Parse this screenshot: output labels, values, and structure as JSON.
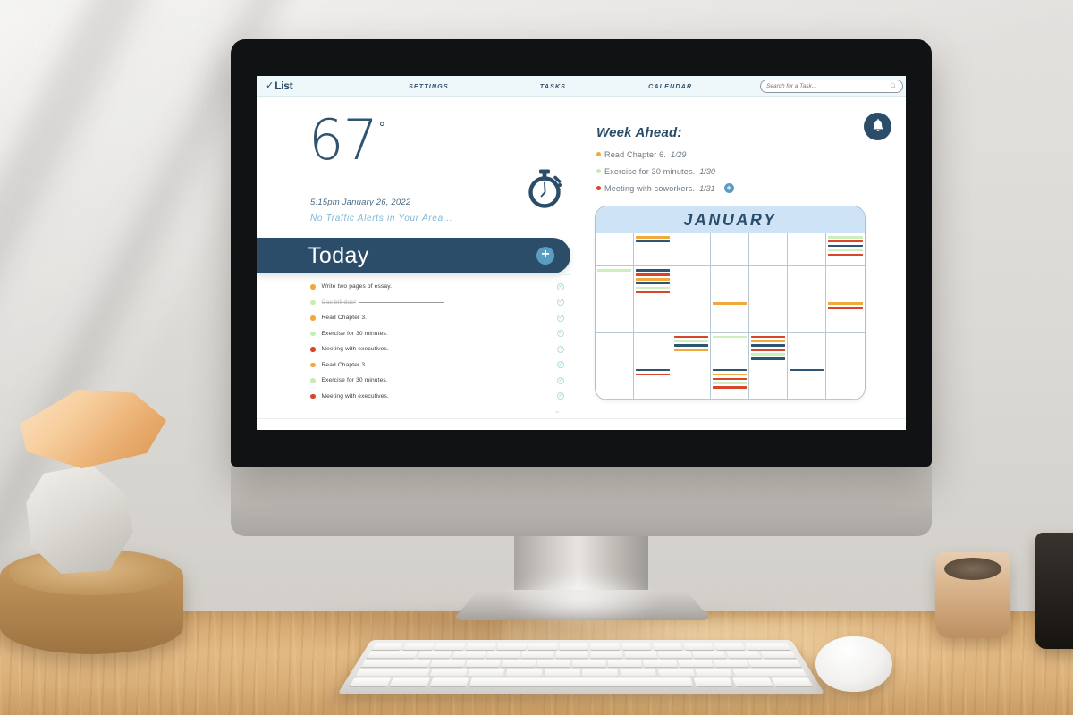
{
  "app": {
    "logo_check": "✓",
    "logo_text": "List"
  },
  "nav": {
    "items": [
      {
        "label": "SETTINGS"
      },
      {
        "label": "TASKS"
      },
      {
        "label": "CALENDAR"
      }
    ]
  },
  "search": {
    "placeholder": "Search for a Task...",
    "value": "",
    "icon": "search-icon"
  },
  "weather": {
    "temperature": "67",
    "degree_symbol": "°",
    "datetime": "5:15pm January 26, 2022",
    "traffic_alert": "No Traffic Alerts in Your Area...",
    "timer_icon": "stopwatch-icon"
  },
  "today": {
    "title": "Today",
    "add_label": "+",
    "expand_icon": "chevron-down-icon",
    "tasks": [
      {
        "text": "Write two pages of essay.",
        "color": "#F2A93B",
        "done": false
      },
      {
        "text": "Gas bill due!",
        "color": "#C8EBB4",
        "done": true
      },
      {
        "text": "Read Chapter 3.",
        "color": "#F2A93B",
        "done": false
      },
      {
        "text": "Exercise for 30 minutes.",
        "color": "#C8EBB4",
        "done": false
      },
      {
        "text": "Meeting with executives.",
        "color": "#D8452A",
        "done": false
      },
      {
        "text": "Read Chapter 3.",
        "color": "#F2A93B",
        "done": false
      },
      {
        "text": "Exercise for 30 minutes.",
        "color": "#C8EBB4",
        "done": false
      },
      {
        "text": "Meeting with executives.",
        "color": "#D8452A",
        "done": false
      }
    ]
  },
  "week_ahead": {
    "title": "Week Ahead:",
    "add_label": "+",
    "items": [
      {
        "text": "Read Chapter 6.",
        "date": "1/29",
        "color": "#F2A93B"
      },
      {
        "text": "Exercise for 30 minutes.",
        "date": "1/30",
        "color": "#C8EBB4"
      },
      {
        "text": "Meeting with coworkers.",
        "date": "1/31",
        "color": "#D8452A"
      }
    ]
  },
  "notifications": {
    "icon": "bell-icon"
  },
  "calendar": {
    "month": "JANUARY",
    "columns": 7,
    "rows": 5,
    "colors": {
      "orange": "#F2A93B",
      "navy": "#2F5575",
      "red": "#D8452A",
      "green": "#CDEFBE"
    },
    "cells": [
      {
        "row": 1,
        "col": 1,
        "events": []
      },
      {
        "row": 1,
        "col": 2,
        "events": [
          "orange",
          "navy"
        ]
      },
      {
        "row": 1,
        "col": 3,
        "events": []
      },
      {
        "row": 1,
        "col": 4,
        "events": []
      },
      {
        "row": 1,
        "col": 5,
        "events": []
      },
      {
        "row": 1,
        "col": 6,
        "events": []
      },
      {
        "row": 1,
        "col": 7,
        "events": [
          "green",
          "red",
          "navy",
          "green",
          "red"
        ]
      },
      {
        "row": 2,
        "col": 1,
        "events": [
          "green"
        ]
      },
      {
        "row": 2,
        "col": 2,
        "events": [
          "navy",
          "red",
          "orange",
          "navy",
          "green",
          "red"
        ]
      },
      {
        "row": 2,
        "col": 3,
        "events": []
      },
      {
        "row": 2,
        "col": 4,
        "events": []
      },
      {
        "row": 2,
        "col": 5,
        "events": []
      },
      {
        "row": 2,
        "col": 6,
        "events": []
      },
      {
        "row": 2,
        "col": 7,
        "events": []
      },
      {
        "row": 3,
        "col": 1,
        "events": []
      },
      {
        "row": 3,
        "col": 2,
        "events": []
      },
      {
        "row": 3,
        "col": 3,
        "events": []
      },
      {
        "row": 3,
        "col": 4,
        "events": [
          "orange"
        ]
      },
      {
        "row": 3,
        "col": 5,
        "events": []
      },
      {
        "row": 3,
        "col": 6,
        "events": []
      },
      {
        "row": 3,
        "col": 7,
        "events": [
          "orange",
          "red"
        ]
      },
      {
        "row": 4,
        "col": 1,
        "events": []
      },
      {
        "row": 4,
        "col": 2,
        "events": []
      },
      {
        "row": 4,
        "col": 3,
        "events": [
          "red",
          "green",
          "navy",
          "orange"
        ]
      },
      {
        "row": 4,
        "col": 4,
        "events": [
          "green"
        ]
      },
      {
        "row": 4,
        "col": 5,
        "events": [
          "red",
          "orange",
          "navy",
          "red",
          "green",
          "navy"
        ]
      },
      {
        "row": 4,
        "col": 6,
        "events": []
      },
      {
        "row": 4,
        "col": 7,
        "events": []
      },
      {
        "row": 5,
        "col": 1,
        "events": []
      },
      {
        "row": 5,
        "col": 2,
        "events": [
          "navy",
          "red"
        ]
      },
      {
        "row": 5,
        "col": 3,
        "events": []
      },
      {
        "row": 5,
        "col": 4,
        "events": [
          "navy",
          "orange",
          "red",
          "green",
          "red"
        ]
      },
      {
        "row": 5,
        "col": 5,
        "events": []
      },
      {
        "row": 5,
        "col": 6,
        "events": [
          "navy"
        ]
      },
      {
        "row": 5,
        "col": 7,
        "events": []
      }
    ]
  },
  "theme": {
    "navy": "#2b4d69",
    "light_blue": "#5a9dc0",
    "nav_bg": "#eef7f9",
    "cal_header_bg": "#cfe3f7"
  }
}
